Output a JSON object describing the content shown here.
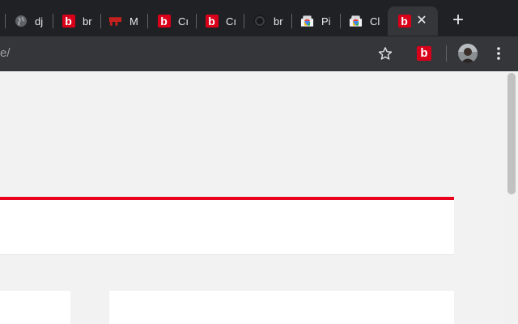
{
  "tabs": [
    {
      "label": "dj",
      "icon": "globe-icon"
    },
    {
      "label": "br",
      "icon": "b-logo-icon"
    },
    {
      "label": "M",
      "icon": "red-flag-icon"
    },
    {
      "label": "Cı",
      "icon": "b-logo-icon"
    },
    {
      "label": "Cı",
      "icon": "b-logo-icon"
    },
    {
      "label": "br",
      "icon": "github-icon"
    },
    {
      "label": "Pi",
      "icon": "chrome-store-icon"
    },
    {
      "label": "Cl",
      "icon": "chrome-store-icon"
    }
  ],
  "active_tab": {
    "icon": "b-logo-icon",
    "close_label": "✕"
  },
  "new_tab_label": "+",
  "toolbar": {
    "url_text": "e/",
    "bookmark_icon": "star-icon",
    "extension_icon": "b-logo-icon",
    "menu_icon": "kebab-menu-icon"
  },
  "b_logo_letter": "b",
  "colors": {
    "accent_red": "#e8001c",
    "logo_red": "#d9001a",
    "tab_strip": "#202124",
    "toolbar": "#35363a",
    "page_bg": "#f2f2f2"
  }
}
